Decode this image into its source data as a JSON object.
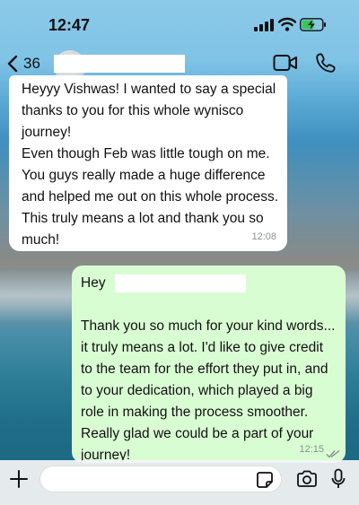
{
  "status_bar": {
    "time": "12:47"
  },
  "header": {
    "back_count": "36"
  },
  "messages": {
    "incoming": {
      "lines": [
        "Heyyy Vishwas! I wanted to say a special",
        "thanks to you for this whole wynisco",
        "journey!",
        "Even though Feb was little tough on me.",
        "You guys really made a huge difference",
        "and helped me out on this whole process.",
        "This truly means a lot and thank you so",
        "much!"
      ],
      "time": "12:08"
    },
    "outgoing": {
      "greeting": "Hey",
      "lines": [
        "Thank you so much for your kind words...",
        "it truly means a lot. I'd like to give credit",
        "to the team for the effort they put in, and",
        "to your dedication, which played a big",
        "role in making the process smoother.",
        "Really glad we could be a part of your",
        "journey!"
      ],
      "time": "12:15"
    }
  },
  "input_bar": {
    "placeholder": ""
  },
  "colors": {
    "incoming_bubble": "#ffffff",
    "outgoing_bubble": "#d9fdd3",
    "read_ticks": "#8a8f93",
    "battery_charging": "#34c759"
  },
  "icons": [
    "back-chevron-icon",
    "video-call-icon",
    "phone-icon",
    "plus-icon",
    "sticker-icon",
    "camera-icon",
    "microphone-icon",
    "signal-icon",
    "wifi-icon",
    "battery-icon",
    "read-ticks-icon"
  ]
}
